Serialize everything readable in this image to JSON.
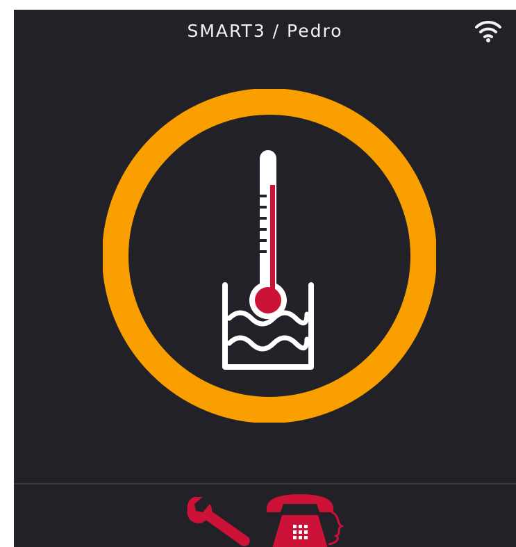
{
  "header": {
    "title": "SMART3 / Pedro"
  },
  "icons": {
    "wifi": "wifi-icon",
    "main": "thermometer-water-bath-icon",
    "settings": "wrench-icon",
    "contact": "telephone-icon"
  },
  "colors": {
    "background": "#222127",
    "ring": "#f9a000",
    "accent": "#cc1236",
    "icon": "#ffffff"
  }
}
